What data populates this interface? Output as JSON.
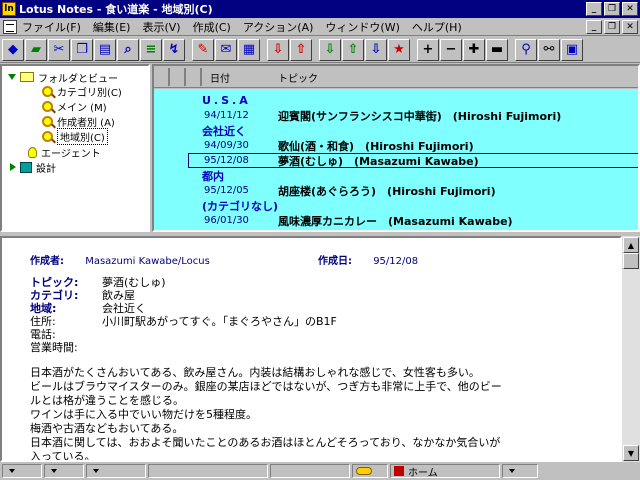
{
  "window": {
    "title": "Lotus Notes - 食い道楽 - 地域別(C)",
    "app_icon": "ln",
    "min": "_",
    "restore": "❐",
    "close": "✕"
  },
  "menu": [
    "ファイル(F)",
    "編集(E)",
    "表示(V)",
    "作成(C)",
    "アクション(A)",
    "ウィンドウ(W)",
    "ヘルプ(H)"
  ],
  "menu_right": {
    "min": "_",
    "restore": "❐",
    "close": "✕"
  },
  "nav": {
    "root_label": "フォルダとビュー",
    "views": [
      "カテゴリ別(C)",
      "メイン (M)",
      "作成者別 (A)",
      "地域別(C)"
    ],
    "agents_label": "エージェント",
    "design_label": "設計"
  },
  "view": {
    "col_date": "日付",
    "col_topic": "トピック",
    "rows": [
      {
        "type": "category",
        "text": "U.S.A"
      },
      {
        "type": "doc",
        "date": "94/11/12",
        "topic": "迎賓閣(サンフランシスコ中華街)　(Hiroshi Fujimori)"
      },
      {
        "type": "category",
        "text": "会社近く"
      },
      {
        "type": "doc",
        "date": "94/09/30",
        "topic": "歌仙(酒・和食)　(Hiroshi Fujimori)"
      },
      {
        "type": "doc",
        "date": "95/12/08",
        "topic": "夢酒(むしゅ)　(Masazumi Kawabe)",
        "selected": true
      },
      {
        "type": "category",
        "text": "都内"
      },
      {
        "type": "doc",
        "date": "95/12/05",
        "topic": "胡座楼(あぐらろう)　(Hiroshi Fujimori)"
      },
      {
        "type": "category",
        "text": "(カテゴリなし)"
      },
      {
        "type": "doc",
        "date": "96/01/30",
        "topic": "風味濃厚カニカレー　(Masazumi Kawabe)"
      }
    ]
  },
  "document": {
    "author_label": "作成者:",
    "author": "Masazumi Kawabe/Locus",
    "date_label": "作成日:",
    "date": "95/12/08",
    "fields": [
      {
        "label": "トピック:",
        "value": "夢酒(むしゅ)",
        "blue": true
      },
      {
        "label": "カテゴリ:",
        "value": "飲み屋",
        "blue": true
      },
      {
        "label": "地域:",
        "value": "会社近く",
        "blue": true
      },
      {
        "label": "住所:",
        "value": "小川町駅あがってすぐ。「まぐろやさん」のB1F",
        "blue": false
      },
      {
        "label": "電話:",
        "value": "",
        "blue": false
      },
      {
        "label": "営業時間:",
        "value": "",
        "blue": false
      }
    ],
    "body": [
      "日本酒がたくさんおいてある、飲み屋さん。内装は結構おしゃれな感じで、女性客も多い。",
      "ビールはブラウマイスターのみ。銀座の某店ほどではないが、つぎ方も非常に上手で、他のビー",
      "ルとは格が違うことを感じる。",
      "ワインは手に入る中でいい物だけを5種程度。",
      "梅酒や古酒などもおいてある。",
      "日本酒に関しては、おおよそ聞いたことのあるお酒はほとんどそろっており、なかなか気合いが",
      "入っている。"
    ]
  },
  "status": {
    "location": "ホーム"
  }
}
